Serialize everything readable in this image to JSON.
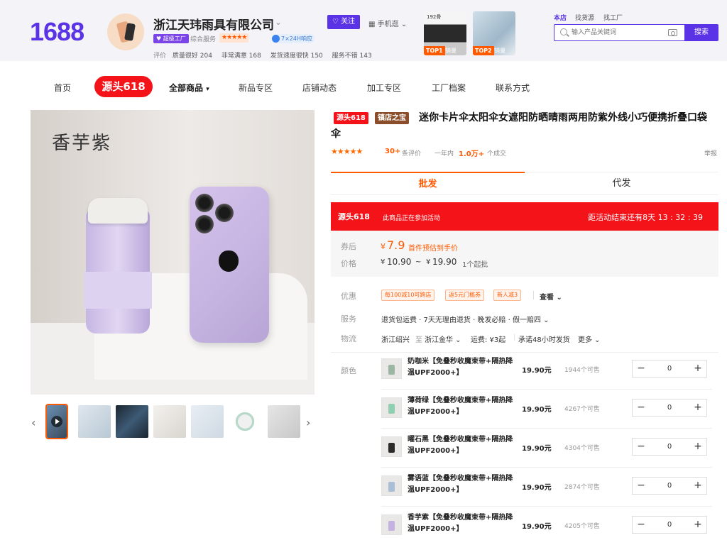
{
  "header": {
    "logo": "1688",
    "shop_name": "浙江天玮雨具有限公司",
    "factory_badge": "♥ 超级工厂",
    "service_label": "综合服务",
    "service_stars": "★★★★★",
    "support_badge": "7×24H响应",
    "metrics_label": "评价",
    "metrics": [
      "质量很好 204",
      "非常满意 168",
      "发货速度很快 150",
      "服务不错 143"
    ],
    "follow_label": "关注",
    "mobile_label": "手机逛",
    "top_products": [
      {
        "rank_label": "TOP1",
        "rank_suffix": "销量",
        "caption": "192骨"
      },
      {
        "rank_label": "TOP2",
        "rank_suffix": "销量",
        "caption": ""
      }
    ]
  },
  "search": {
    "tabs": [
      "本店",
      "找货源",
      "找工厂"
    ],
    "placeholder": "输入产品关键词",
    "button_label": "搜索"
  },
  "nav": {
    "items": [
      "首页",
      "源头618",
      "全部商品",
      "新品专区",
      "店铺动态",
      "加工专区",
      "工厂档案",
      "联系方式"
    ]
  },
  "gallery": {
    "main_caption": "香芋紫",
    "thumb_count": 7
  },
  "product": {
    "tag_618": "源头618",
    "tag_treasure": "镇店之宝",
    "title": "迷你卡片伞太阳伞女遮阳防晒晴雨两用防紫外线小巧便携折叠口袋伞",
    "rating_stars": "★★★★★",
    "review_count": "30+",
    "review_label": "条评价",
    "sold_prefix": "一年内",
    "sold_count": "1.0万+",
    "sold_suffix": "个成交",
    "report_label": "举报"
  },
  "tabs": {
    "wholesale": "批发",
    "dropship": "代发"
  },
  "promo": {
    "logo": "源头618",
    "text": "此商品正在参加活动",
    "countdown": "距活动结束还有8天 13 : 32 : 39"
  },
  "price": {
    "coupon_label": "券后",
    "price_label": "价格",
    "currency": "¥",
    "coupon_price": "7.9",
    "coupon_note": "首件预估到手价",
    "range_low": "10.90",
    "range_sep": "~",
    "range_high": "19.90",
    "moq": "1个起批"
  },
  "offers": {
    "label": "优惠",
    "chips": [
      "每100减10可跨店",
      "返5元门槛券",
      "新人减3"
    ],
    "view_label": "查看 ⌄"
  },
  "service": {
    "label": "服务",
    "text": "退货包运费 · 7天无理由退货 · 晚发必赔 · 假一赔四 ⌄"
  },
  "logistics": {
    "label": "物流",
    "from": "浙江绍兴",
    "to_word": "至",
    "to": "浙江金华 ⌄",
    "freight": "运费: ¥3起",
    "promise": "承诺48小时发货",
    "more": "更多 ⌄"
  },
  "sku": {
    "label": "颜色",
    "items": [
      {
        "name": "奶咖米【免叠秒收魔束带+隔热降温UPF2000+】",
        "price": "19.90元",
        "stock": "1944个可售",
        "qty": "0",
        "color": "#9bb6a2"
      },
      {
        "name": "薄荷绿【免叠秒收魔束带+隔热降温UPF2000+】",
        "price": "19.90元",
        "stock": "4267个可售",
        "qty": "0",
        "color": "#8fd0b0"
      },
      {
        "name": "曜石黑【免叠秒收魔束带+隔热降温UPF2000+】",
        "price": "19.90元",
        "stock": "4304个可售",
        "qty": "0",
        "color": "#2b2b2b"
      },
      {
        "name": "雾语蓝【免叠秒收魔束带+隔热降温UPF2000+】",
        "price": "19.90元",
        "stock": "2874个可售",
        "qty": "0",
        "color": "#a9bfd8"
      },
      {
        "name": "香芋紫【免叠秒收魔束带+隔热降温UPF2000+】",
        "price": "19.90元",
        "stock": "4205个可售",
        "qty": "0",
        "color": "#c4b2e0"
      }
    ],
    "minus_symbol": "−",
    "plus_symbol": "+"
  },
  "colors": {
    "brand": "#5b33e6",
    "accent": "#ff5a00",
    "promo_red": "#f5131a"
  }
}
